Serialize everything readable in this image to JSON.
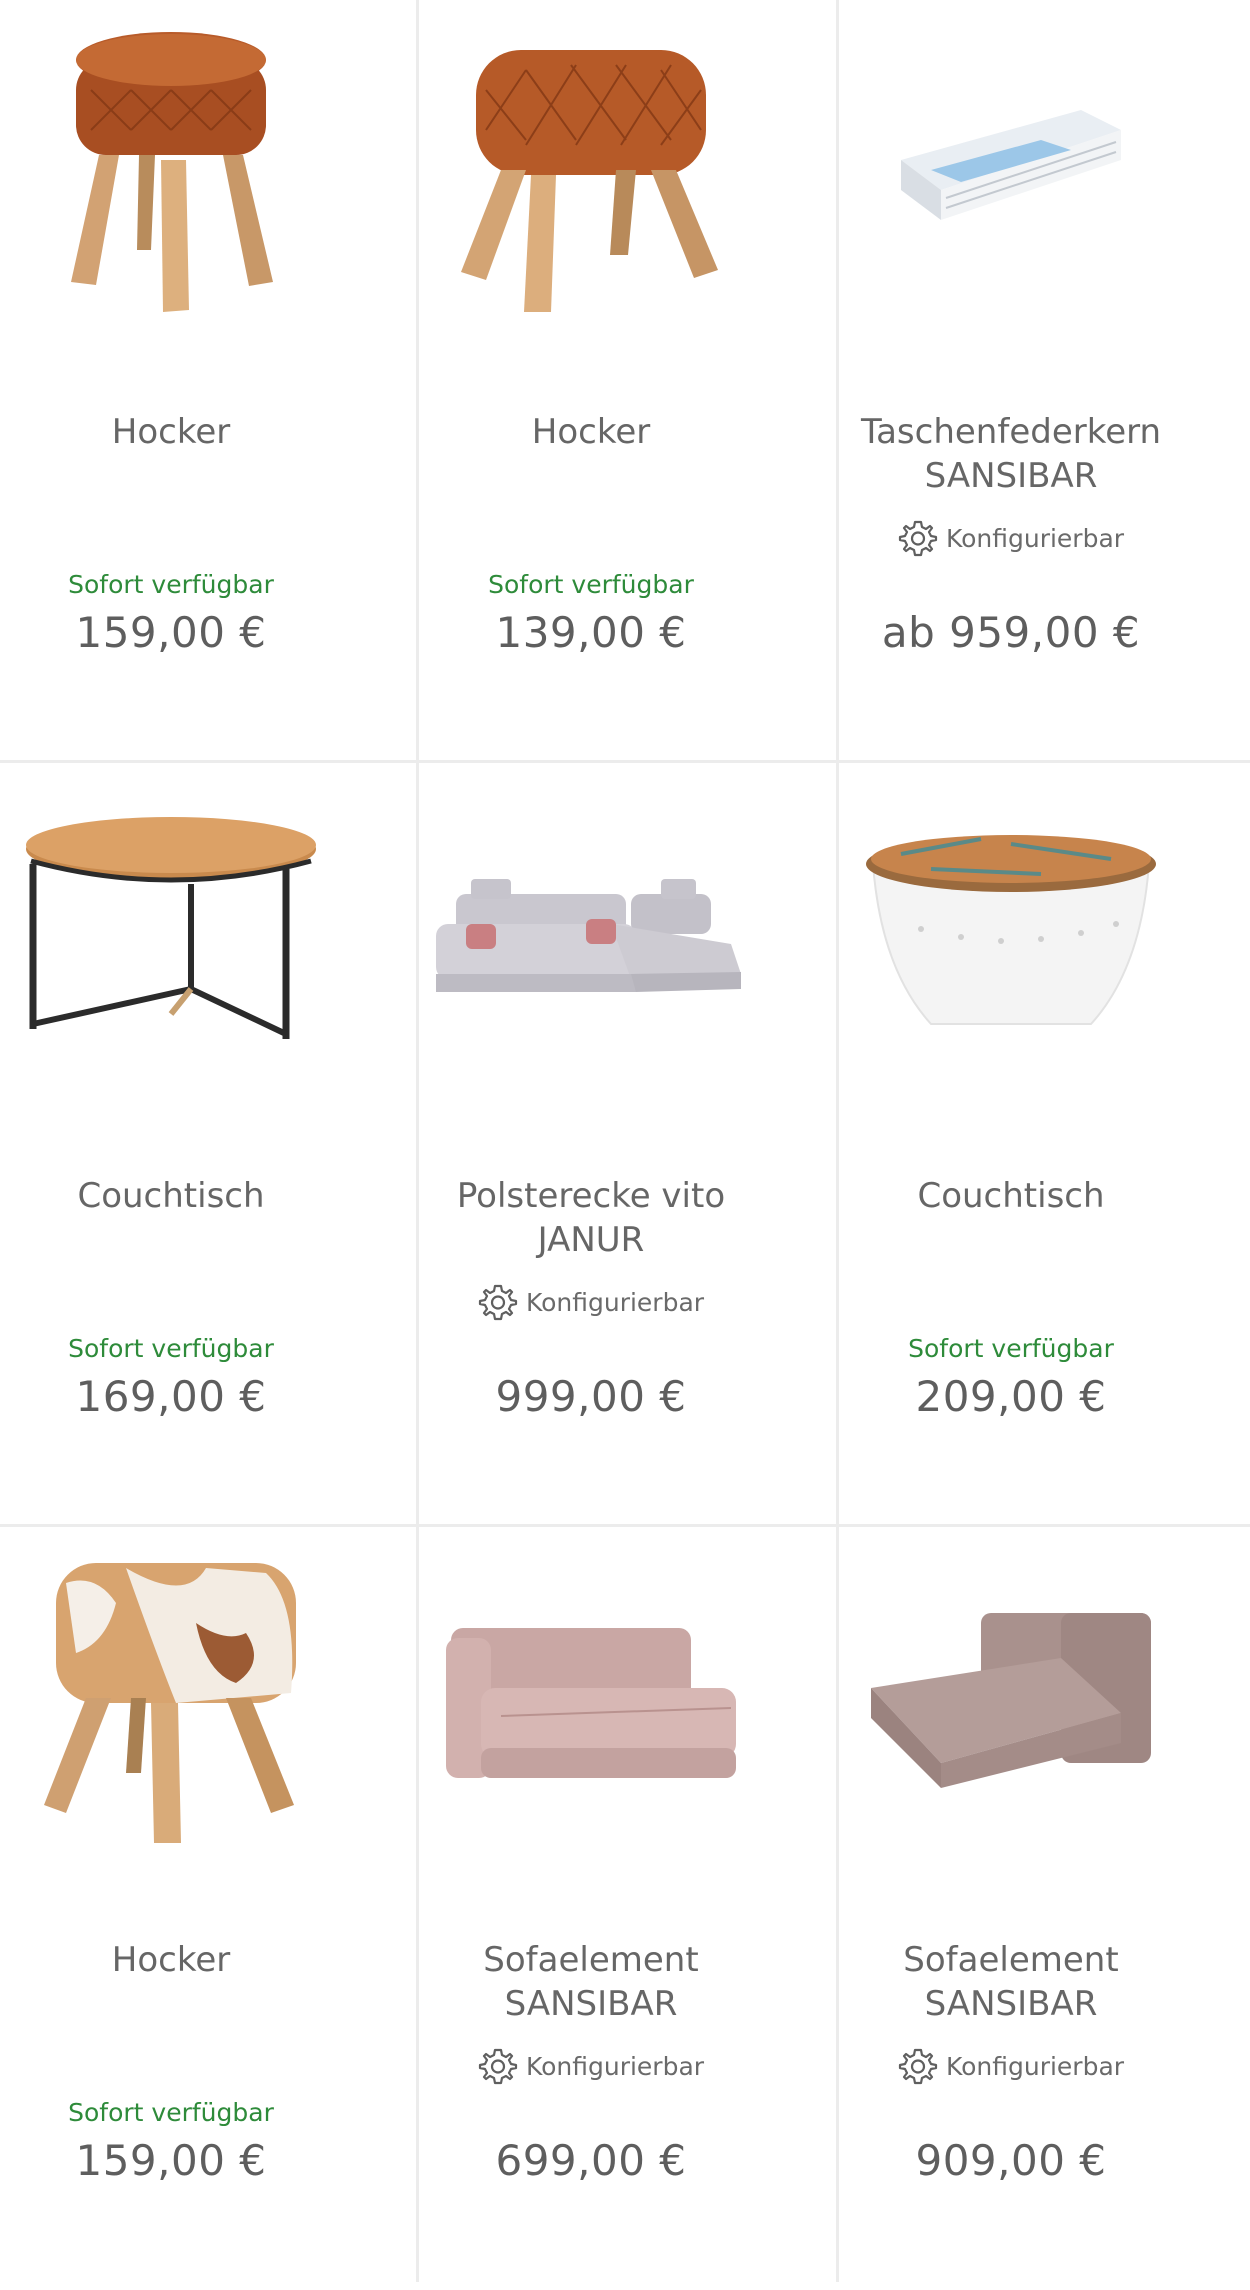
{
  "products": [
    {
      "name_lines": [
        "Hocker"
      ],
      "configurable": "",
      "availability": "Sofort verfügbar",
      "price": "159,00 €",
      "image": "leather-stool-round"
    },
    {
      "name_lines": [
        "Hocker"
      ],
      "configurable": "",
      "availability": "Sofort verfügbar",
      "price": "139,00 €",
      "image": "leather-stool-pommel"
    },
    {
      "name_lines": [
        "Taschenfederkern",
        "SANSIBAR"
      ],
      "configurable": "Konfigurierbar",
      "availability": "",
      "price": "ab 959,00 €",
      "image": "mattress"
    },
    {
      "name_lines": [
        "Couchtisch"
      ],
      "configurable": "",
      "availability": "Sofort verfügbar",
      "price": "169,00 €",
      "image": "round-wood-coffee-table"
    },
    {
      "name_lines": [
        "Polsterecke vito",
        "JANUR"
      ],
      "configurable": "Konfigurierbar",
      "availability": "",
      "price": "999,00 €",
      "image": "corner-sofa-grey"
    },
    {
      "name_lines": [
        "Couchtisch"
      ],
      "configurable": "",
      "availability": "Sofort verfügbar",
      "price": "209,00 €",
      "image": "drum-coffee-table"
    },
    {
      "name_lines": [
        "Hocker"
      ],
      "configurable": "",
      "availability": "Sofort verfügbar",
      "price": "159,00 €",
      "image": "cowhide-stool"
    },
    {
      "name_lines": [
        "Sofaelement",
        "SANSIBAR"
      ],
      "configurable": "Konfigurierbar",
      "availability": "",
      "price": "699,00 €",
      "image": "sofa-element-pink"
    },
    {
      "name_lines": [
        "Sofaelement",
        "SANSIBAR"
      ],
      "configurable": "Konfigurierbar",
      "availability": "",
      "price": "909,00 €",
      "image": "sofa-chaise-taupe"
    }
  ],
  "colors": {
    "availability": "#2e8b3a",
    "price": "#5e5e5e",
    "divider": "#ececec"
  },
  "icons": {
    "configurable": "gear-icon"
  }
}
